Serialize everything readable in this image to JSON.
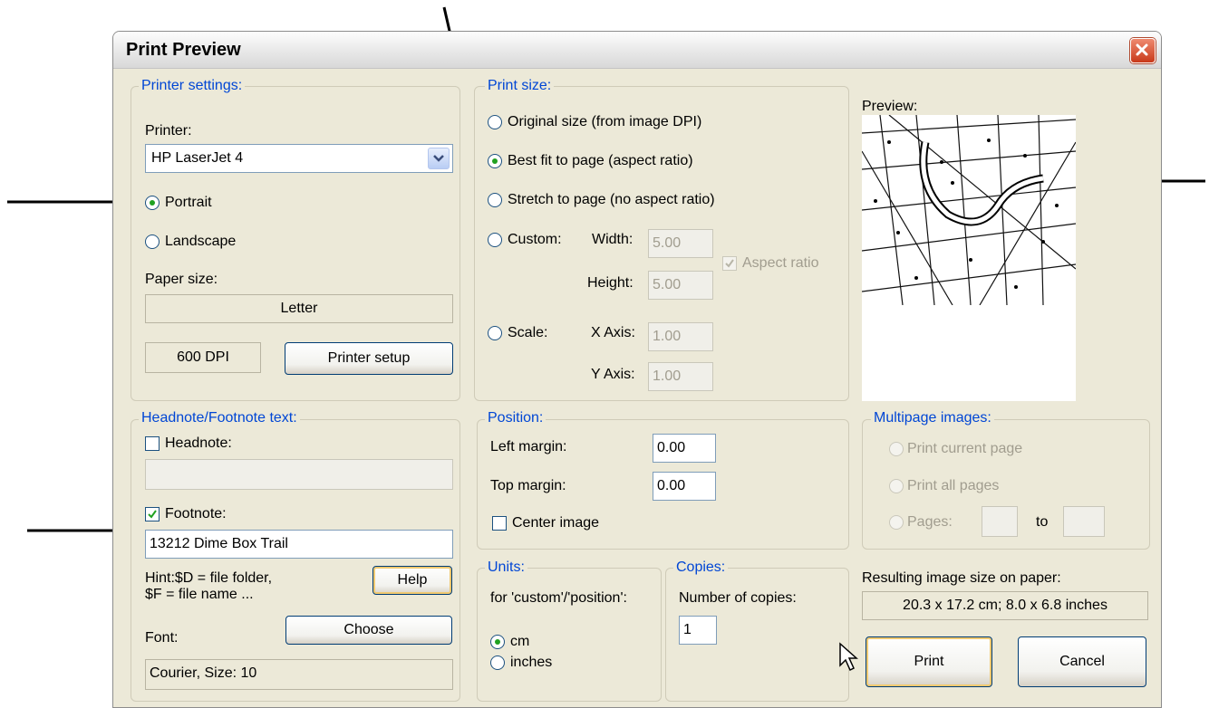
{
  "window": {
    "title": "Print Preview"
  },
  "printer_settings": {
    "legend": "Printer settings:",
    "printer_label": "Printer:",
    "printer_value": "HP LaserJet 4",
    "portrait_label": "Portrait",
    "landscape_label": "Landscape",
    "orientation_selected": "Portrait",
    "paper_size_label": "Paper size:",
    "paper_size_value": "Letter",
    "dpi_value": "600 DPI",
    "printer_setup_label": "Printer setup"
  },
  "print_size": {
    "legend": "Print size:",
    "original_label": "Original size (from image DPI)",
    "best_fit_label": "Best fit to page (aspect ratio)",
    "stretch_label": "Stretch to page (no aspect ratio)",
    "custom_label": "Custom:",
    "width_label": "Width:",
    "width_value": "5.00",
    "height_label": "Height:",
    "height_value": "5.00",
    "aspect_ratio_label": "Aspect ratio",
    "scale_label": "Scale:",
    "x_axis_label": "X Axis:",
    "x_axis_value": "1.00",
    "y_axis_label": "Y Axis:",
    "y_axis_value": "1.00",
    "selected": "Best fit to page (aspect ratio)"
  },
  "preview": {
    "label": "Preview:"
  },
  "headnote_footnote": {
    "legend": "Headnote/Footnote text:",
    "headnote_label": "Headnote:",
    "headnote_checked": false,
    "headnote_value": "",
    "footnote_label": "Footnote:",
    "footnote_checked": true,
    "footnote_value": "13212 Dime Box Trail",
    "hint_line1": "Hint:$D = file folder,",
    "hint_line2": "$F = file name ...",
    "help_label": "Help",
    "font_label": "Font:",
    "choose_label": "Choose",
    "font_value": "Courier, Size: 10"
  },
  "position": {
    "legend": "Position:",
    "left_margin_label": "Left margin:",
    "left_margin_value": "0.00",
    "top_margin_label": "Top margin:",
    "top_margin_value": "0.00",
    "center_image_label": "Center image",
    "center_checked": false
  },
  "multipage": {
    "legend": "Multipage images:",
    "current_page_label": "Print current page",
    "all_pages_label": "Print all pages",
    "pages_label": "Pages:",
    "to_label": "to",
    "from_value": "",
    "to_value": ""
  },
  "units": {
    "legend": "Units:",
    "for_label": "for 'custom'/'position':",
    "cm_label": "cm",
    "inches_label": "inches",
    "selected": "cm"
  },
  "copies": {
    "legend": "Copies:",
    "number_label": "Number of copies:",
    "number_value": "1"
  },
  "result": {
    "label": "Resulting image size on paper:",
    "value": "20.3 x 17.2 cm; 8.0 x 6.8 inches"
  },
  "actions": {
    "print_label": "Print",
    "cancel_label": "Cancel"
  },
  "colors": {
    "dialog_bg": "#ece9d8",
    "legend_text": "#0046d5",
    "radio_dot": "#21a121",
    "close_button": "#d9532c"
  }
}
